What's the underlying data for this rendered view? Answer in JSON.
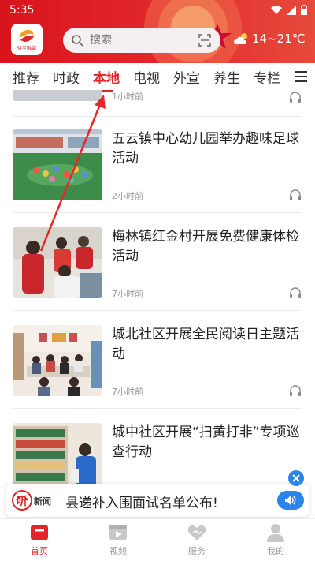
{
  "status_bar": {
    "time": "5:35"
  },
  "header": {
    "logo_text": "待至融媒",
    "search": {
      "placeholder": "搜索"
    },
    "weather": {
      "temperature": "14~21℃",
      "icon": "cloud-sun-icon"
    }
  },
  "tabs": [
    {
      "label": "推荐",
      "active": false
    },
    {
      "label": "时政",
      "active": false
    },
    {
      "label": "本地",
      "active": true
    },
    {
      "label": "电视",
      "active": false
    },
    {
      "label": "外宣",
      "active": false
    },
    {
      "label": "养生",
      "active": false
    },
    {
      "label": "专栏",
      "active": false
    }
  ],
  "feed": {
    "partial_item": {
      "time": "1小时前"
    },
    "items": [
      {
        "title": "五云镇中心幼儿园举办趣味足球活动",
        "time": "2小时前"
      },
      {
        "title": "梅林镇红金村开展免费健康体检活动",
        "time": "7小时前"
      },
      {
        "title": "城北社区开展全民阅读日主题活动",
        "time": "7小时前"
      },
      {
        "title": "城中社区开展“扫黄打非”专项巡查行动",
        "time": ""
      }
    ]
  },
  "banner": {
    "logo_text_1": "听",
    "logo_text_2": "新闻",
    "text": "县递补入围面试名单公布!"
  },
  "bottom_nav": [
    {
      "label": "首页",
      "icon": "home-icon",
      "active": true
    },
    {
      "label": "视频",
      "icon": "video-icon",
      "active": false
    },
    {
      "label": "服务",
      "icon": "service-icon",
      "active": false
    },
    {
      "label": "我的",
      "icon": "user-icon",
      "active": false
    }
  ],
  "colors": {
    "brand_red": "#e0262a",
    "accent_blue": "#2b85e8"
  }
}
